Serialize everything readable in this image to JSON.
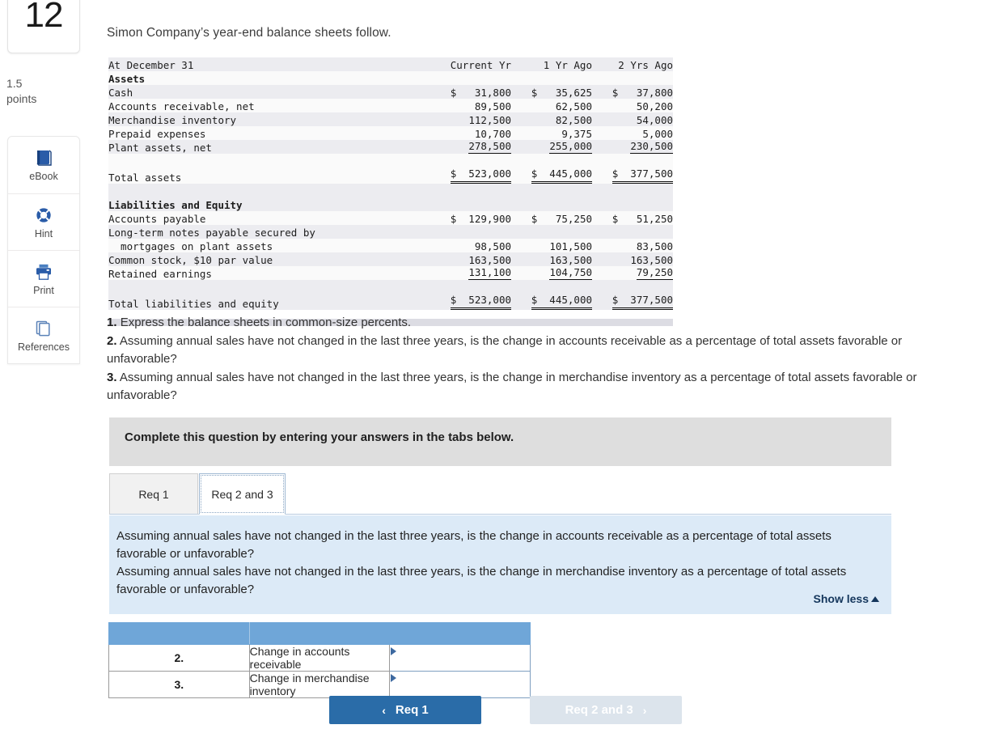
{
  "sidebar": {
    "question_number": "12",
    "points_value": "1.5",
    "points_label": "points",
    "tools": [
      {
        "label": "eBook",
        "icon": "book-icon"
      },
      {
        "label": "Hint",
        "icon": "life-preserver-icon"
      },
      {
        "label": "Print",
        "icon": "printer-icon"
      },
      {
        "label": "References",
        "icon": "copy-stack-icon"
      }
    ]
  },
  "intro": "Simon Company’s year-end balance sheets follow.",
  "balance_sheet": {
    "columns": [
      "At December 31",
      "Current Yr",
      "1 Yr Ago",
      "2 Yrs Ago"
    ],
    "sections": [
      {
        "heading": "Assets",
        "rows": [
          {
            "label": "Cash",
            "values": [
              "$   31,800",
              "$   35,625",
              "$   37,800"
            ]
          },
          {
            "label": "Accounts receivable, net",
            "values": [
              "89,500",
              "62,500",
              "50,200"
            ]
          },
          {
            "label": "Merchandise inventory",
            "values": [
              "112,500",
              "82,500",
              "54,000"
            ]
          },
          {
            "label": "Prepaid expenses",
            "values": [
              "10,700",
              "9,375",
              "5,000"
            ]
          },
          {
            "label": "Plant assets, net",
            "values": [
              "278,500",
              "255,000",
              "230,500"
            ]
          }
        ],
        "total": {
          "label": "Total assets",
          "values": [
            "$  523,000",
            "$  445,000",
            "$  377,500"
          ]
        }
      },
      {
        "heading": "Liabilities and Equity",
        "rows": [
          {
            "label": "Accounts payable",
            "values": [
              "$  129,900",
              "$   75,250",
              "$   51,250"
            ]
          },
          {
            "label": "Long-term notes payable secured by",
            "values": [
              "",
              "",
              ""
            ]
          },
          {
            "label": "  mortgages on plant assets",
            "values": [
              "98,500",
              "101,500",
              "83,500"
            ]
          },
          {
            "label": "Common stock, $10 par value",
            "values": [
              "163,500",
              "163,500",
              "163,500"
            ]
          },
          {
            "label": "Retained earnings",
            "values": [
              "131,100",
              "104,750",
              "79,250"
            ]
          }
        ],
        "total": {
          "label": "Total liabilities and equity",
          "values": [
            "$  523,000",
            "$  445,000",
            "$  377,500"
          ]
        }
      }
    ]
  },
  "requirements": [
    {
      "num": "1.",
      "text": "Express the balance sheets in common-size percents."
    },
    {
      "num": "2.",
      "text": "Assuming annual sales have not changed in the last three years, is the change in accounts receivable as a percentage of total assets favorable or unfavorable?"
    },
    {
      "num": "3.",
      "text": "Assuming annual sales have not changed in the last three years, is the change in merchandise inventory as a percentage of total assets favorable or unfavorable?"
    }
  ],
  "instruction_bar": "Complete this question by entering your answers in the tabs below.",
  "tabs": [
    {
      "label": "Req 1",
      "active": false
    },
    {
      "label": "Req 2 and 3",
      "active": true
    }
  ],
  "panel": {
    "lines": [
      "Assuming annual sales have not changed in the last three years, is the change in accounts receivable as a percentage of total assets favorable or unfavorable?",
      "Assuming annual sales have not changed in the last three years, is the change in merchandise inventory as a percentage of total assets favorable or unfavorable?"
    ],
    "show_less_label": "Show less"
  },
  "answer_table": {
    "rows": [
      {
        "num": "2.",
        "description": "Change in accounts receivable",
        "value": ""
      },
      {
        "num": "3.",
        "description": "Change in merchandise inventory",
        "value": ""
      }
    ]
  },
  "nav": {
    "prev_label": "Req 1",
    "prev_chevron": "‹",
    "next_label": "Req 2 and 3",
    "next_chevron": "›"
  },
  "colors": {
    "accent_blue": "#2a6ca8",
    "panel_blue": "#dceaf7",
    "header_blue": "#6fa6d8",
    "instruction_gray": "#dedede",
    "link_navy": "#14365c"
  }
}
